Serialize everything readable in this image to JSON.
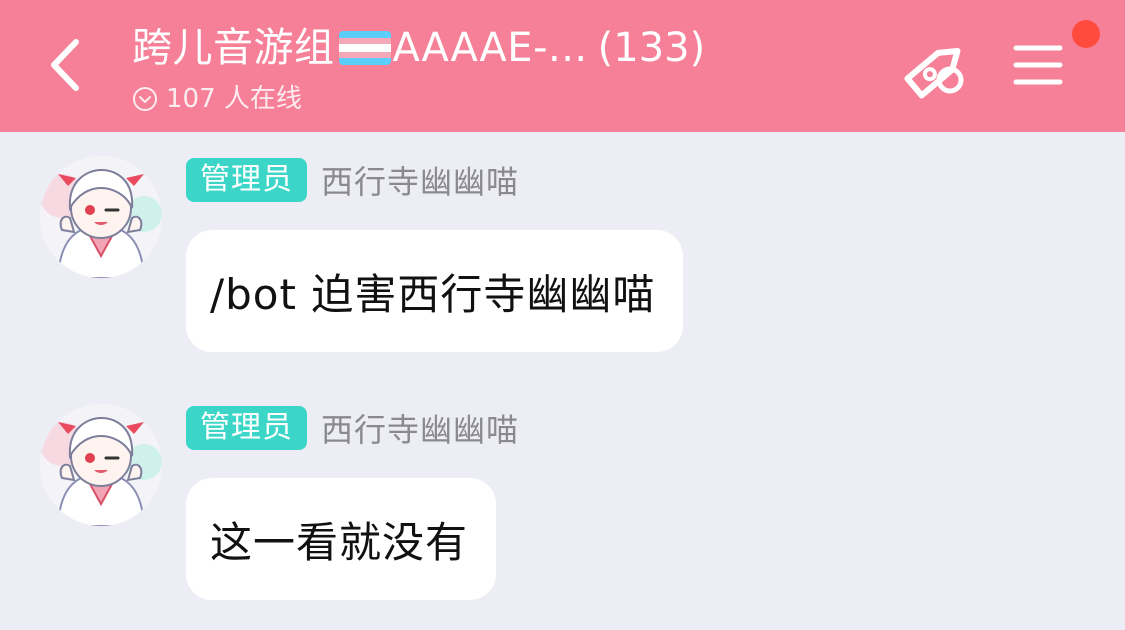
{
  "header": {
    "group_name": "跨儿音游组",
    "flag_icon": "transgender-flag",
    "group_id": "AAAAE-...",
    "member_count": "(133)",
    "online_text": "107 人在线",
    "background": "#F58097",
    "notification_dot_color": "#FF4B3E"
  },
  "messages": [
    {
      "role_badge": "管理员",
      "sender": "西行寺幽幽喵",
      "text": "/bot 迫害西行寺幽幽喵"
    },
    {
      "role_badge": "管理员",
      "sender": "西行寺幽幽喵",
      "text": "这一看就没有"
    }
  ],
  "colors": {
    "badge": "#3CD6C8",
    "chat_background": "#ECEDF5",
    "bubble": "#FFFFFF"
  }
}
